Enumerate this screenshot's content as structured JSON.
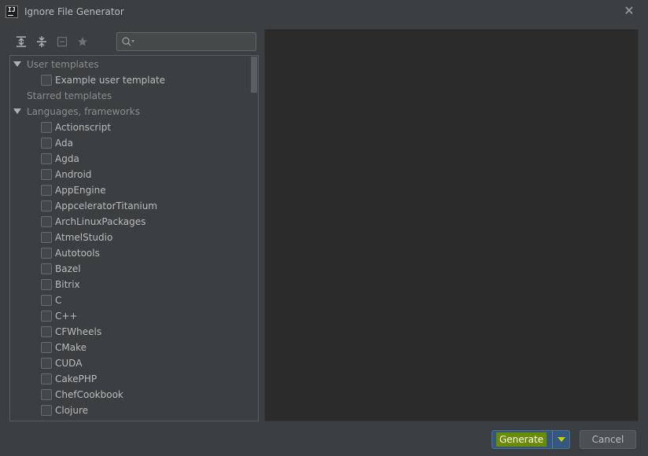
{
  "window": {
    "title": "Ignore File Generator",
    "app_icon_text": "IJ"
  },
  "toolbar": {
    "icons": [
      "expand-all-icon",
      "collapse-all-icon",
      "remove-icon",
      "star-icon"
    ]
  },
  "search": {
    "placeholder": "",
    "value": ""
  },
  "tree": {
    "groups": [
      {
        "label": "User templates",
        "expanded": true,
        "items": [
          "Example user template"
        ]
      },
      {
        "label": "Starred templates",
        "expanded": false,
        "items": []
      },
      {
        "label": "Languages, frameworks",
        "expanded": true,
        "items": [
          "Actionscript",
          "Ada",
          "Agda",
          "Android",
          "AppEngine",
          "AppceleratorTitanium",
          "ArchLinuxPackages",
          "AtmelStudio",
          "Autotools",
          "Bazel",
          "Bitrix",
          "C",
          "C++",
          "CFWheels",
          "CMake",
          "CUDA",
          "CakePHP",
          "ChefCookbook",
          "Clojure"
        ]
      }
    ]
  },
  "buttons": {
    "generate": "Generate",
    "cancel": "Cancel"
  },
  "colors": {
    "background": "#3c3f41",
    "preview_background": "#2b2b2b",
    "primary_button": "#365880",
    "highlight": "#6a8c00"
  }
}
